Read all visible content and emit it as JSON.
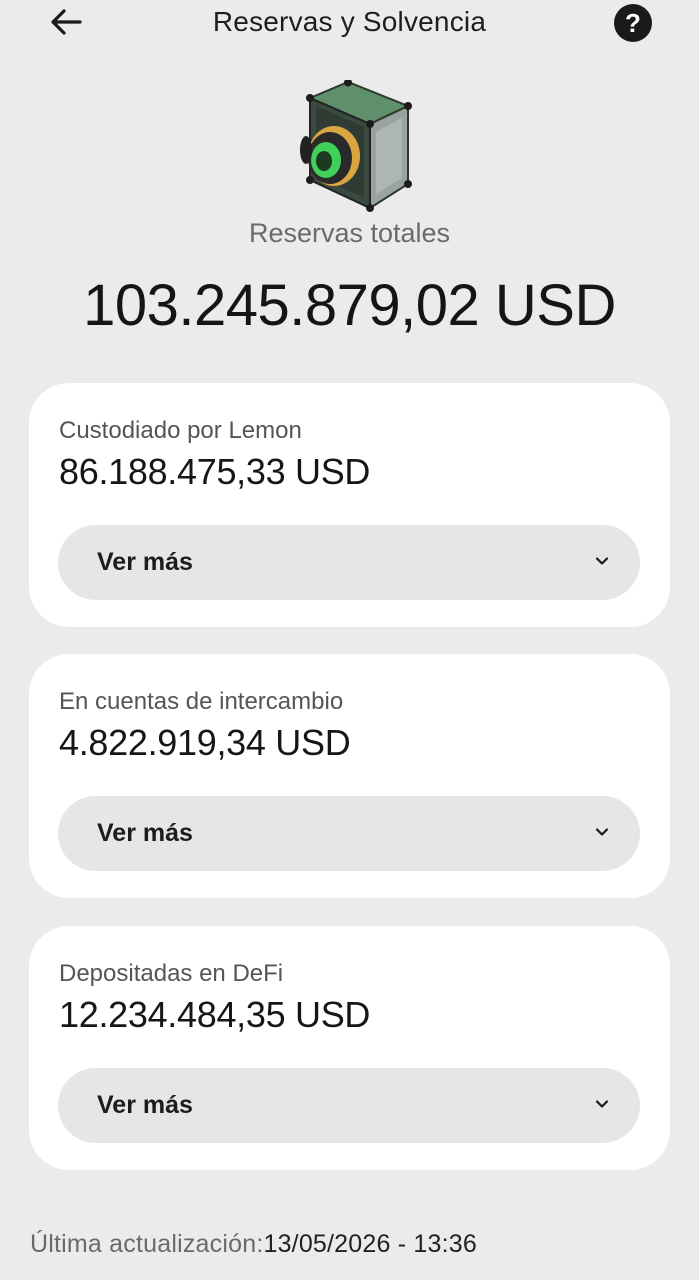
{
  "header": {
    "title": "Reservas y Solvencia",
    "back_icon": "arrow-left-icon",
    "help_icon": "question-circle-icon",
    "help_glyph": "?"
  },
  "hero": {
    "icon": "vault-icon",
    "label": "Reservas totales",
    "value": "103.245.879,02 USD"
  },
  "cards": [
    {
      "label": "Custodiado por Lemon",
      "value": "86.188.475,33 USD",
      "button": "Ver más"
    },
    {
      "label": "En cuentas de intercambio",
      "value": "4.822.919,34 USD",
      "button": "Ver más"
    },
    {
      "label": "Depositadas en DeFi",
      "value": "12.234.484,35 USD",
      "button": "Ver más"
    }
  ],
  "footer": {
    "label": "Última actualización:",
    "timestamp": "13/05/2026 - 13:36"
  },
  "colors": {
    "background": "#ebebeb",
    "card": "#ffffff",
    "button": "#e6e6e6",
    "accent_green": "#3fd15a"
  }
}
